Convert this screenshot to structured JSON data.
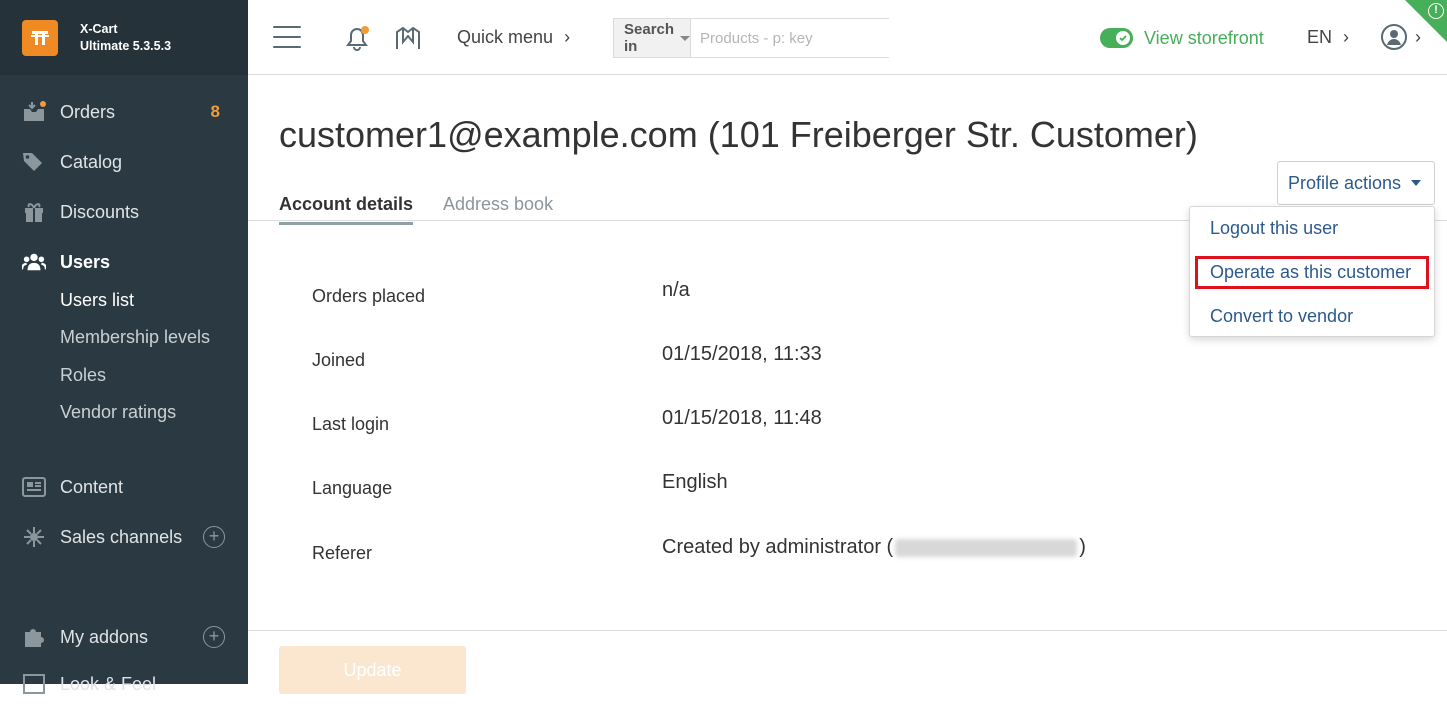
{
  "brand": {
    "name": "X-Cart",
    "version": "Ultimate 5.3.5.3"
  },
  "sidebar": {
    "items": [
      {
        "label": "Orders",
        "badge": "8"
      },
      {
        "label": "Catalog"
      },
      {
        "label": "Discounts"
      },
      {
        "label": "Users"
      },
      {
        "label": "Content"
      },
      {
        "label": "Sales channels"
      },
      {
        "label": "My addons"
      },
      {
        "label": "Look & Feel"
      }
    ],
    "users_sub": [
      "Users list",
      "Membership levels",
      "Roles",
      "Vendor ratings"
    ]
  },
  "header": {
    "quick_menu": "Quick menu",
    "search_scope": "Search in",
    "search_placeholder": "Products - p: key",
    "view_storefront": "View storefront",
    "language": "EN"
  },
  "page": {
    "title": "customer1@example.com (101 Freiberger Str. Customer)",
    "tabs": [
      "Account details",
      "Address book"
    ],
    "profile_actions": {
      "label": "Profile actions",
      "items": [
        "Logout this user",
        "Operate as this customer",
        "Convert to vendor"
      ]
    },
    "details": [
      {
        "label": "Orders placed",
        "value": "n/a"
      },
      {
        "label": "Joined",
        "value": "01/15/2018, 11:33"
      },
      {
        "label": "Last login",
        "value": "01/15/2018, 11:48"
      },
      {
        "label": "Language",
        "value": "English"
      },
      {
        "label": "Referer",
        "value_prefix": "Created by administrator (",
        "value_suffix": ")"
      }
    ],
    "update_button": "Update"
  },
  "colors": {
    "accent_green": "#47ae5a",
    "orange": "#f08a24",
    "link_blue": "#2c5a8c",
    "highlight_red": "#e0101c"
  }
}
